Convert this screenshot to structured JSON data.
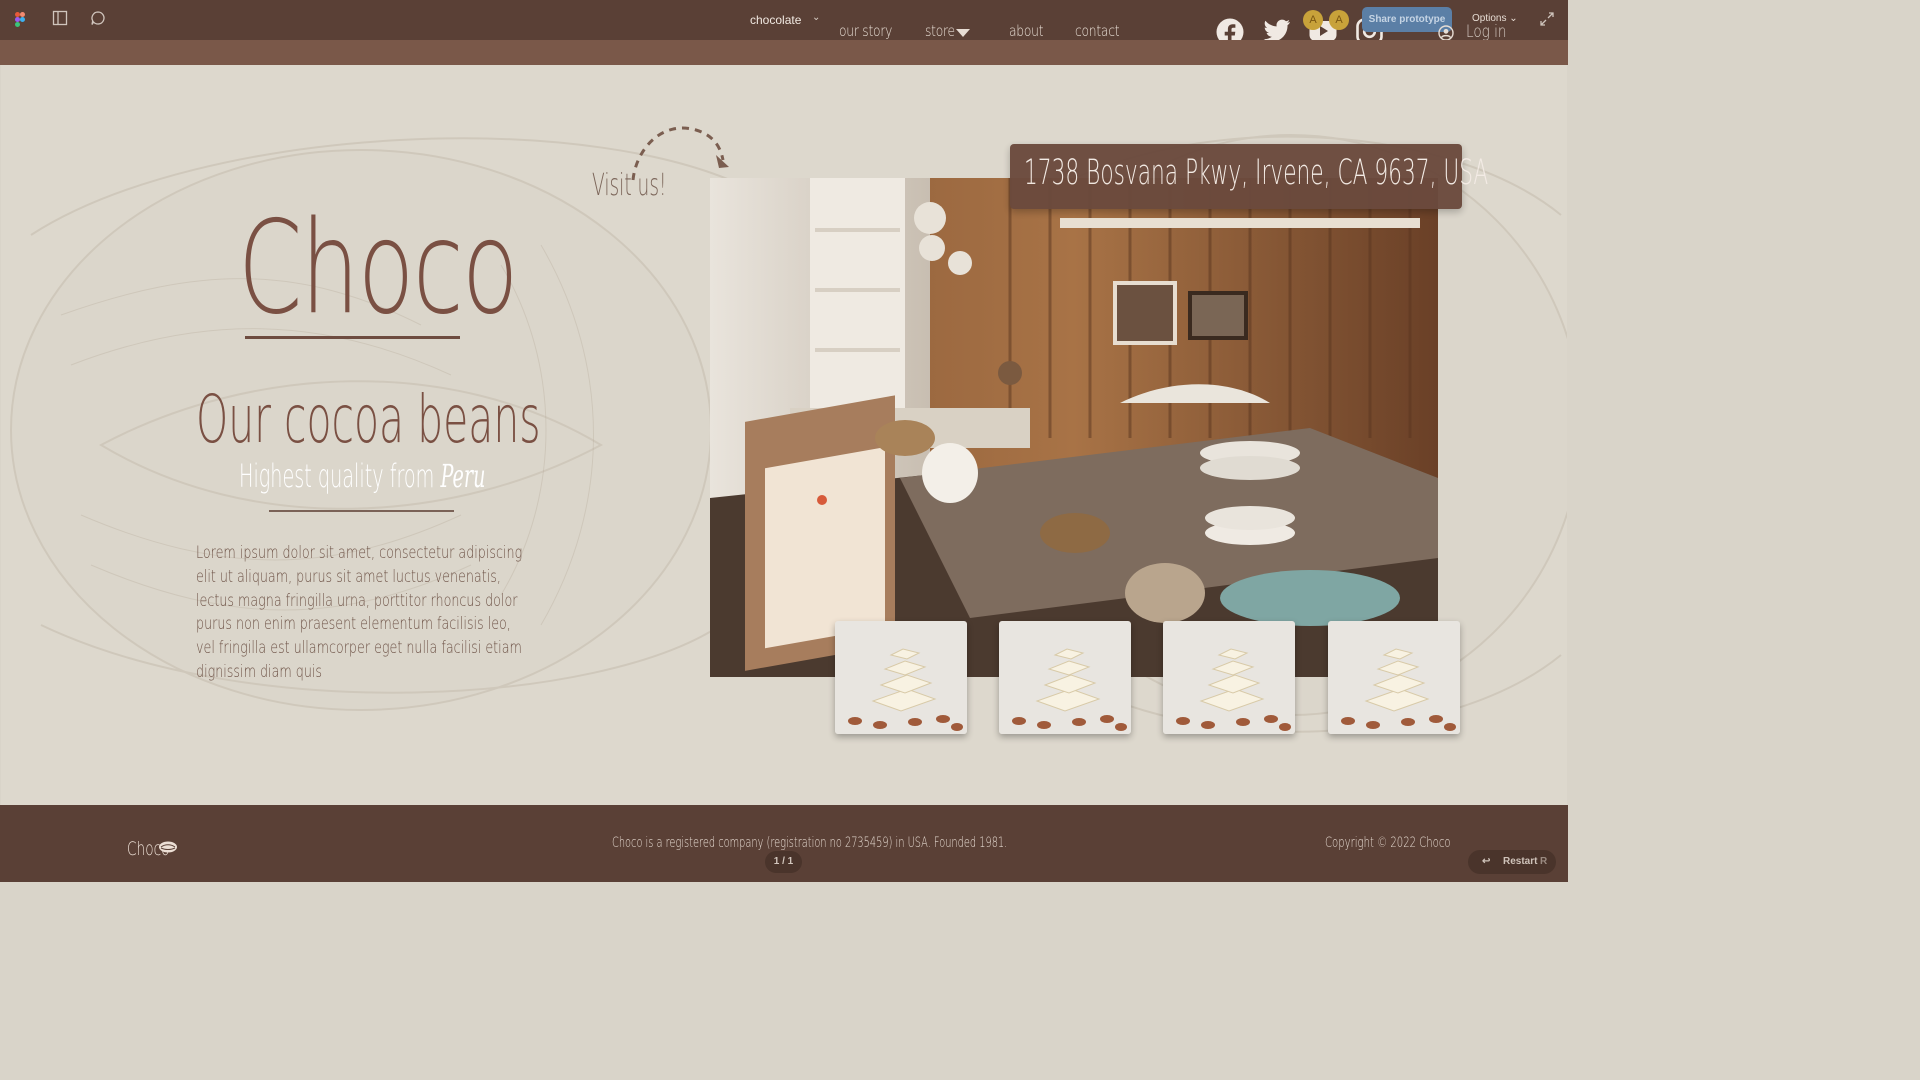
{
  "figma": {
    "file_name": "chocolate",
    "share_label": "Share prototype",
    "options_label": "Options",
    "avatar_initials": [
      "A",
      "A"
    ],
    "page_indicator": "1 / 1",
    "restart_label": "Restart",
    "restart_shortcut": "R"
  },
  "nav": {
    "links": [
      "our story",
      "store",
      "about",
      "contact"
    ],
    "login_label": "Log in",
    "social_icons": [
      "facebook-icon",
      "twitter-icon",
      "youtube-icon",
      "instagram-icon"
    ]
  },
  "hero": {
    "visit_label": "Visit us!",
    "logo": "Choco",
    "heading": "Our cocoa beans",
    "subheading_prefix": "Highest quality from",
    "subheading_place": "Peru",
    "body": "Lorem ipsum dolor sit amet, consectetur adipiscing elit ut aliquam, purus sit amet luctus venenatis, lectus magna fringilla urna, porttitor rhoncus dolor purus non enim praesent elementum facilisis leo, vel fringilla est ullamcorper eget nulla facilisi etiam dignissim diam quis",
    "address": "1738 Bosvana Pkwy, Irvene, CA 9637, USA"
  },
  "footer": {
    "logo": "Choco",
    "company_note": "Choco is a registered company (registration no 2735459) in USA. Founded 1981.",
    "copyright": "Copyright © 2022 Choco"
  },
  "colors": {
    "bar": "#5a4036",
    "strip": "#7a5849",
    "canvas": "#ddd8cd",
    "accent_brown": "#7a5043",
    "share_blue": "#5b7fa6"
  }
}
